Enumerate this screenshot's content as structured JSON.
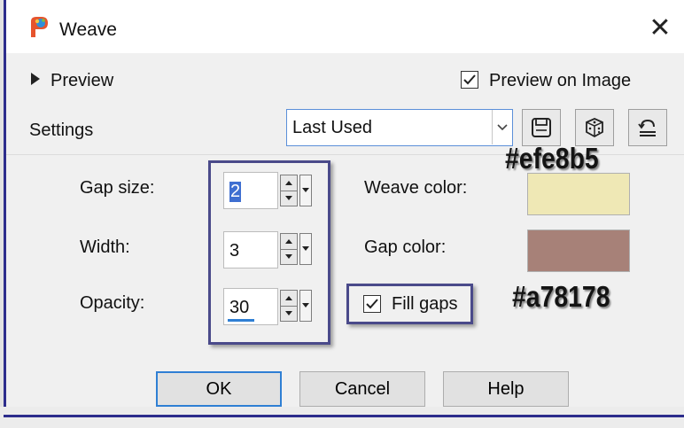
{
  "window": {
    "title": "Weave",
    "close_glyph": "✕",
    "app_icon": "paintshop-icon"
  },
  "preview": {
    "toggle_label": "Preview",
    "preview_on_image_label": "Preview on Image",
    "preview_on_image_checked": true
  },
  "settings": {
    "label": "Settings",
    "preset_value": "Last Used",
    "tool_buttons": [
      "save-preset-icon",
      "randomize-dice-icon",
      "reset-icon"
    ]
  },
  "params": {
    "gap_size": {
      "label": "Gap size:",
      "value": "2"
    },
    "width": {
      "label": "Width:",
      "value": "3"
    },
    "opacity": {
      "label": "Opacity:",
      "value": "30"
    }
  },
  "colors": {
    "weave_label": "Weave color:",
    "weave_hex": "#efe8b5",
    "gap_label": "Gap color:",
    "gap_hex": "#a78178",
    "annotation_weave": "#efe8b5",
    "annotation_gap": "#a78178"
  },
  "fill_gaps": {
    "label": "Fill gaps",
    "checked": true
  },
  "buttons": {
    "ok": "OK",
    "cancel": "Cancel",
    "help": "Help"
  }
}
